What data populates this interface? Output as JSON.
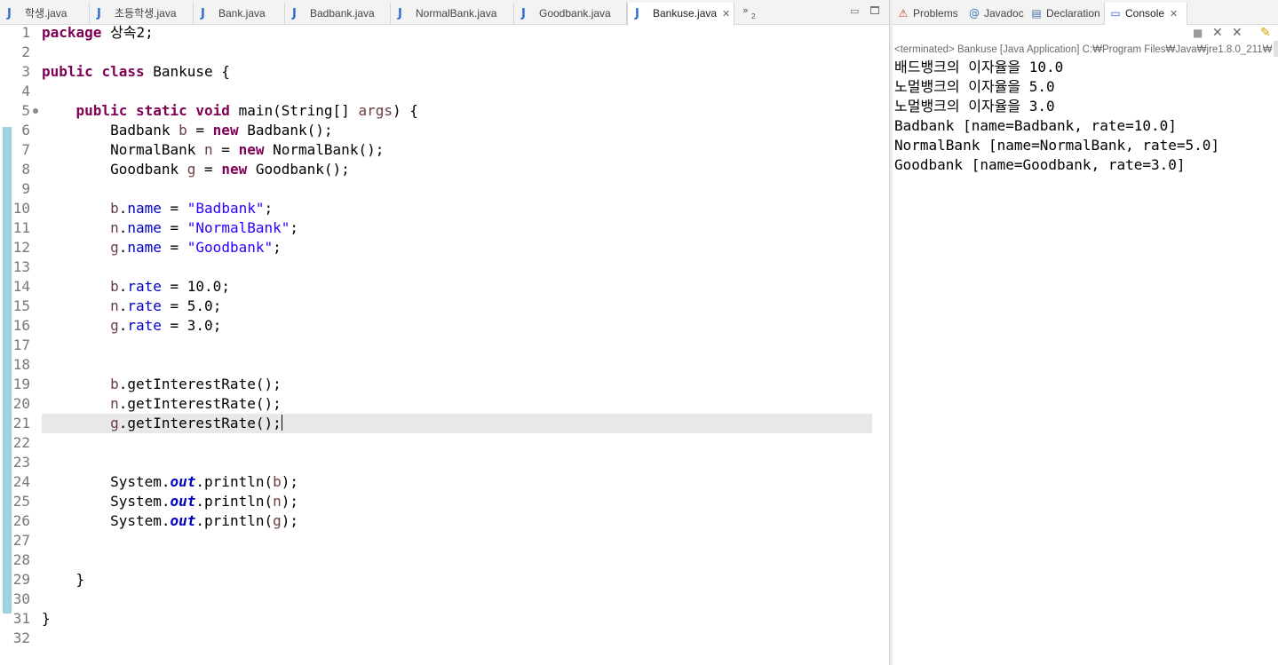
{
  "editor": {
    "tabs": [
      {
        "label": "학생.java"
      },
      {
        "label": "초등학생.java"
      },
      {
        "label": "Bank.java"
      },
      {
        "label": "Badbank.java"
      },
      {
        "label": "NormalBank.java"
      },
      {
        "label": "Goodbank.java"
      },
      {
        "label": "Bankuse.java",
        "active": true
      }
    ],
    "java_icon_glyph": "J",
    "close_glyph": "✕",
    "overflow_glyph": "»",
    "overflow_count": "2",
    "minimize_glyph": "▭",
    "line_numbers": [
      "1",
      "2",
      "3",
      "4",
      "5",
      "6",
      "7",
      "8",
      "9",
      "10",
      "11",
      "12",
      "13",
      "14",
      "15",
      "16",
      "17",
      "18",
      "19",
      "20",
      "21",
      "22",
      "23",
      "24",
      "25",
      "26",
      "27",
      "28",
      "29",
      "30",
      "31",
      "32"
    ],
    "code": {
      "l1_kw": "package",
      "l1_rest": " 상속2;",
      "l3_kw1": "public",
      "l3_kw2": "class",
      "l3_rest": " Bankuse {",
      "l5_kw1": "public",
      "l5_kw2": "static",
      "l5_kw3": "void",
      "l5_a": " main(String[] ",
      "l5_var": "args",
      "l5_b": ") {",
      "l6_a": "Badbank ",
      "l6_var": "b",
      "l6_b": " = ",
      "l6_kw": "new",
      "l6_c": " Badbank();",
      "l7_a": "NormalBank ",
      "l7_var": "n",
      "l7_b": " = ",
      "l7_kw": "new",
      "l7_c": " NormalBank();",
      "l8_a": "Goodbank ",
      "l8_var": "g",
      "l8_b": " = ",
      "l8_kw": "new",
      "l8_c": " Goodbank();",
      "l10_var": "b",
      "l10_fld": "name",
      "l10_str": "\"Badbank\"",
      "l11_var": "n",
      "l11_fld": "name",
      "l11_str": "\"NormalBank\"",
      "l12_var": "g",
      "l12_fld": "name",
      "l12_str": "\"Goodbank\"",
      "l14_var": "b",
      "l14_fld": "rate",
      "l14_val": "10.0",
      "l15_var": "n",
      "l15_fld": "rate",
      "l15_val": "5.0",
      "l16_var": "g",
      "l16_fld": "rate",
      "l16_val": "3.0",
      "l19_var": "b",
      "l19_call": ".getInterestRate();",
      "l20_var": "n",
      "l20_call": ".getInterestRate();",
      "l21_var": "g",
      "l21_call": ".getInterestRate();",
      "sys": "System.",
      "out": "out",
      "println": ".println(",
      "l24_var": "b",
      "l25_var": "n",
      "l26_var": "g",
      "close_call": ");",
      "dot": ".",
      "assign": " = ",
      "semi": ";",
      "l29": "}",
      "l31": "}"
    }
  },
  "console": {
    "tabs": [
      {
        "label": "Problems",
        "icon": "⚠"
      },
      {
        "label": "Javadoc",
        "icon": "@"
      },
      {
        "label": "Declaration",
        "icon": "▤"
      },
      {
        "label": "Console",
        "icon": "▭",
        "active": true
      }
    ],
    "close_glyph": "✕",
    "toolbar": {
      "terminate": "■",
      "remove": "✕",
      "remove_all": "✕",
      "clear": "✎"
    },
    "status": "<terminated> Bankuse [Java Application] C:₩Program Files₩Java₩jre1.8.0_211₩",
    "output": [
      "배드뱅크의 이자율을 10.0",
      "노멀뱅크의 이자율을 5.0",
      "노멀뱅크의 이자율을 3.0",
      "Badbank [name=Badbank, rate=10.0]",
      "NormalBank [name=NormalBank, rate=5.0]",
      "Goodbank [name=Goodbank, rate=3.0]"
    ]
  }
}
